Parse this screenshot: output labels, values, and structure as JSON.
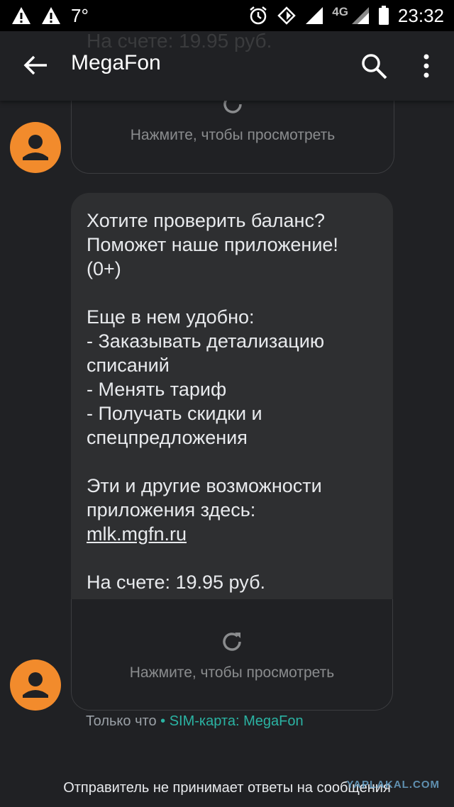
{
  "status_bar": {
    "temperature": "7°",
    "network_type": "4G",
    "time": "23:32"
  },
  "app_bar": {
    "ghost_text": "На счете: 19.95 руб.",
    "title": "MegaFon"
  },
  "messages": [
    {
      "text": "",
      "preview_label": "Нажмите, чтобы просмотреть"
    },
    {
      "text": "Хотите проверить баланс? Поможет наше приложение! (0+)\n\nЕще в нем удобно:\n- Заказывать детализацию списаний\n- Менять тариф\n- Получать скидки и спецпредложения\n\nЭти и другие возможности приложения здесь:",
      "link": "mlk.mgfn.ru",
      "text_after": "На счете: 19.95 руб.",
      "preview_label": "Нажмите, чтобы просмотреть",
      "time": "Только что",
      "separator": " • ",
      "sim": "SIM-карта: MegaFon"
    }
  ],
  "footer_note": "Отправитель не принимает ответы на сообщения",
  "watermark": "YAPLAKAL.COM",
  "colors": {
    "avatar": "#f28b2c",
    "sim_accent": "#2bb3a3",
    "background": "#202124"
  }
}
